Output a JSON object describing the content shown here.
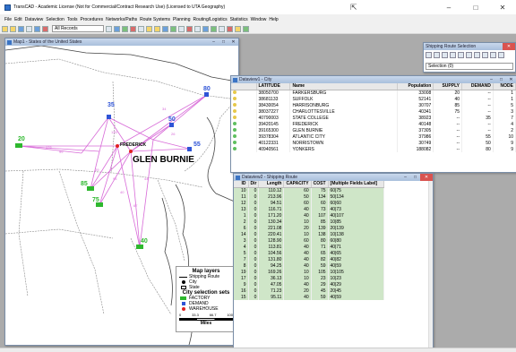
{
  "app": {
    "title": "TransCAD - Academic License (Not for Commercial/Contract Research Use) (Licensed to UTA Geography)",
    "window_controls": [
      "–",
      "□",
      "✕"
    ]
  },
  "menu": [
    "File",
    "Edit",
    "Dataview",
    "Selection",
    "Tools",
    "Procedures",
    "Networks/Paths",
    "Route Systems",
    "Planning",
    "Routing/Logistics",
    "Statistics",
    "Window",
    "Help"
  ],
  "toolbar": {
    "records_select": "All Records"
  },
  "map_window": {
    "title": "Map1 - States of the United States",
    "labels": {
      "frederick": "FREDERICK",
      "glen_burnie": "GLEN BURNIE",
      "n80": "80",
      "n35": "35",
      "n50": "50",
      "n55": "55",
      "n20": "20",
      "n85": "85",
      "n75": "75",
      "n40": "40",
      "e1": "135",
      "e2": "34",
      "e3": "176",
      "e4": "99",
      "e5": "29",
      "e6": "40",
      "e7": "44",
      "e8": "26",
      "e9": "67",
      "e10": "95"
    },
    "legend": {
      "title": "Map layers",
      "shipping_route": "Shipping Route",
      "city": "City",
      "state": "State",
      "sets_title": "City selection sets",
      "factory": "FACTORY",
      "demand": "DEMAND",
      "warehouse": "WAREHOUSE",
      "scale_ticks": [
        "0",
        "33.3",
        "66.7",
        "100"
      ],
      "scale_unit": "Miles"
    }
  },
  "city_window": {
    "title": "Dataview1 - City",
    "columns": [
      "LATITUDE",
      "Name",
      "Population",
      "SUPPLY",
      "DEMAND",
      "NODE"
    ],
    "rows": [
      {
        "lat": "38050700",
        "name": "FARKERSBURG",
        "pop": "33008",
        "supply": "20",
        "demand": "--",
        "node": "1"
      },
      {
        "lat": "38681133",
        "name": "SUFFOLK",
        "pop": "52141",
        "supply": "40",
        "demand": "--",
        "node": "1"
      },
      {
        "lat": "38430054",
        "name": "HARRISONBURG",
        "pop": "30707",
        "supply": "85",
        "demand": "--",
        "node": "5"
      },
      {
        "lat": "38037227",
        "name": "CHARLOTTESVILLE",
        "pop": "40341",
        "supply": "75",
        "demand": "--",
        "node": "3"
      },
      {
        "lat": "40790003",
        "name": "STATE COLLEGE",
        "pop": "38923",
        "supply": "--",
        "demand": "35",
        "node": "7"
      },
      {
        "lat": "39420145",
        "name": "FREDERICK",
        "pop": "40148",
        "supply": "--",
        "demand": "--",
        "node": "4"
      },
      {
        "lat": "39165300",
        "name": "GLEN BURNIE",
        "pop": "37305",
        "supply": "--",
        "demand": "--",
        "node": "2"
      },
      {
        "lat": "39378304",
        "name": "ATLANTIC CITY",
        "pop": "37986",
        "supply": "--",
        "demand": "55",
        "node": "10"
      },
      {
        "lat": "40122331",
        "name": "NORRISTOWN",
        "pop": "30749",
        "supply": "--",
        "demand": "50",
        "node": "9"
      },
      {
        "lat": "40940561",
        "name": "YONKERS",
        "pop": "188082",
        "supply": "--",
        "demand": "80",
        "node": "9"
      }
    ]
  },
  "ship_sel_window": {
    "title": "Shipping Route Selection",
    "selection": "Selection (0)"
  },
  "route_window": {
    "title": "Dataview2 - Shipping Route",
    "columns": [
      "ID",
      "Dir",
      "Length",
      "CAPACITY",
      "COST",
      "[Multiple Fields Label]"
    ],
    "rows": [
      {
        "id": "10",
        "dir": "0",
        "len": "110.12",
        "cap": "60",
        "cost": "75",
        "lbl": "60|75"
      },
      {
        "id": "11",
        "dir": "0",
        "len": "213.96",
        "cap": "50",
        "cost": "134",
        "lbl": "50|134"
      },
      {
        "id": "12",
        "dir": "0",
        "len": "94.51",
        "cap": "60",
        "cost": "60",
        "lbl": "60|60"
      },
      {
        "id": "13",
        "dir": "0",
        "len": "116.71",
        "cap": "40",
        "cost": "73",
        "lbl": "40|73"
      },
      {
        "id": "1",
        "dir": "0",
        "len": "171.20",
        "cap": "40",
        "cost": "107",
        "lbl": "40|107"
      },
      {
        "id": "2",
        "dir": "0",
        "len": "130.34",
        "cap": "10",
        "cost": "85",
        "lbl": "10|85"
      },
      {
        "id": "6",
        "dir": "0",
        "len": "221.08",
        "cap": "20",
        "cost": "139",
        "lbl": "20|139"
      },
      {
        "id": "14",
        "dir": "0",
        "len": "220.41",
        "cap": "10",
        "cost": "138",
        "lbl": "10|138"
      },
      {
        "id": "3",
        "dir": "0",
        "len": "128.90",
        "cap": "60",
        "cost": "80",
        "lbl": "60|80"
      },
      {
        "id": "4",
        "dir": "0",
        "len": "113.81",
        "cap": "40",
        "cost": "71",
        "lbl": "40|71"
      },
      {
        "id": "5",
        "dir": "0",
        "len": "104.56",
        "cap": "40",
        "cost": "65",
        "lbl": "40|65"
      },
      {
        "id": "7",
        "dir": "0",
        "len": "131.80",
        "cap": "40",
        "cost": "82",
        "lbl": "40|82"
      },
      {
        "id": "8",
        "dir": "0",
        "len": "94.25",
        "cap": "40",
        "cost": "59",
        "lbl": "40|59"
      },
      {
        "id": "19",
        "dir": "0",
        "len": "169.26",
        "cap": "10",
        "cost": "105",
        "lbl": "10|105"
      },
      {
        "id": "17",
        "dir": "0",
        "len": "36.13",
        "cap": "10",
        "cost": "23",
        "lbl": "10|23"
      },
      {
        "id": "9",
        "dir": "0",
        "len": "47.05",
        "cap": "40",
        "cost": "29",
        "lbl": "40|29"
      },
      {
        "id": "16",
        "dir": "0",
        "len": "71.23",
        "cap": "20",
        "cost": "45",
        "lbl": "20|45"
      },
      {
        "id": "15",
        "dir": "0",
        "len": "95.11",
        "cap": "40",
        "cost": "59",
        "lbl": "40|59"
      }
    ]
  },
  "colors": {
    "factory": "#2eb82e",
    "demand": "#2f54d6",
    "warehouse": "#e02020",
    "route": "#d86bd8"
  }
}
